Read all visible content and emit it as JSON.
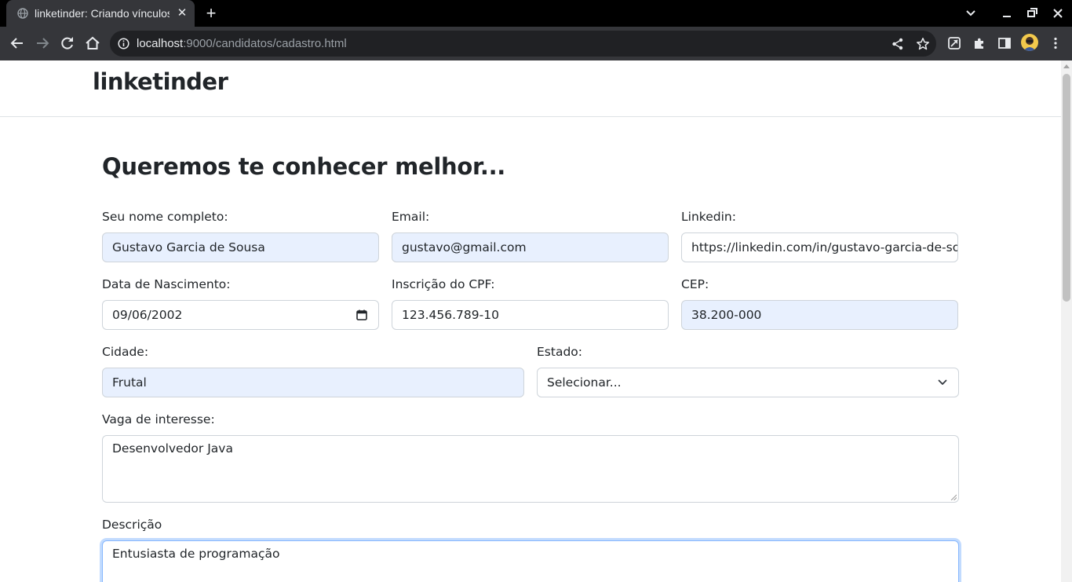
{
  "browser": {
    "tab_title": "linketinder: Criando vínculos",
    "url_host": "localhost",
    "url_path": ":9000/candidatos/cadastro.html"
  },
  "site": {
    "brand": "linketinder"
  },
  "form": {
    "title": "Queremos te conhecer melhor...",
    "nome": {
      "label": "Seu nome completo:",
      "value": "Gustavo Garcia de Sousa"
    },
    "email": {
      "label": "Email:",
      "value": "gustavo@gmail.com"
    },
    "linkedin": {
      "label": "Linkedin:",
      "value": "https://linkedin.com/in/gustavo-garcia-de-sousa"
    },
    "nascimento": {
      "label": "Data de Nascimento:",
      "value": "09/06/2002"
    },
    "cpf": {
      "label": "Inscrição do CPF:",
      "value": "123.456.789-10"
    },
    "cep": {
      "label": "CEP:",
      "value": "38.200-000"
    },
    "cidade": {
      "label": "Cidade:",
      "value": "Frutal"
    },
    "estado": {
      "label": "Estado:",
      "value": "Selecionar..."
    },
    "vaga": {
      "label": "Vaga de interesse:",
      "value": "Desenvolvedor Java"
    },
    "descricao": {
      "label": "Descrição",
      "value": "Entusiasta de programação"
    }
  },
  "icons": {
    "favicon": "globe-icon",
    "back": "back-arrow-icon",
    "forward": "forward-arrow-icon",
    "reload": "reload-icon",
    "home": "home-icon",
    "share": "share-icon",
    "bookmark": "star-icon",
    "extensions": "puzzle-icon"
  },
  "colors": {
    "autofill": "#e8f0fe",
    "focus_ring": "#86b7fe",
    "text": "#212529"
  }
}
